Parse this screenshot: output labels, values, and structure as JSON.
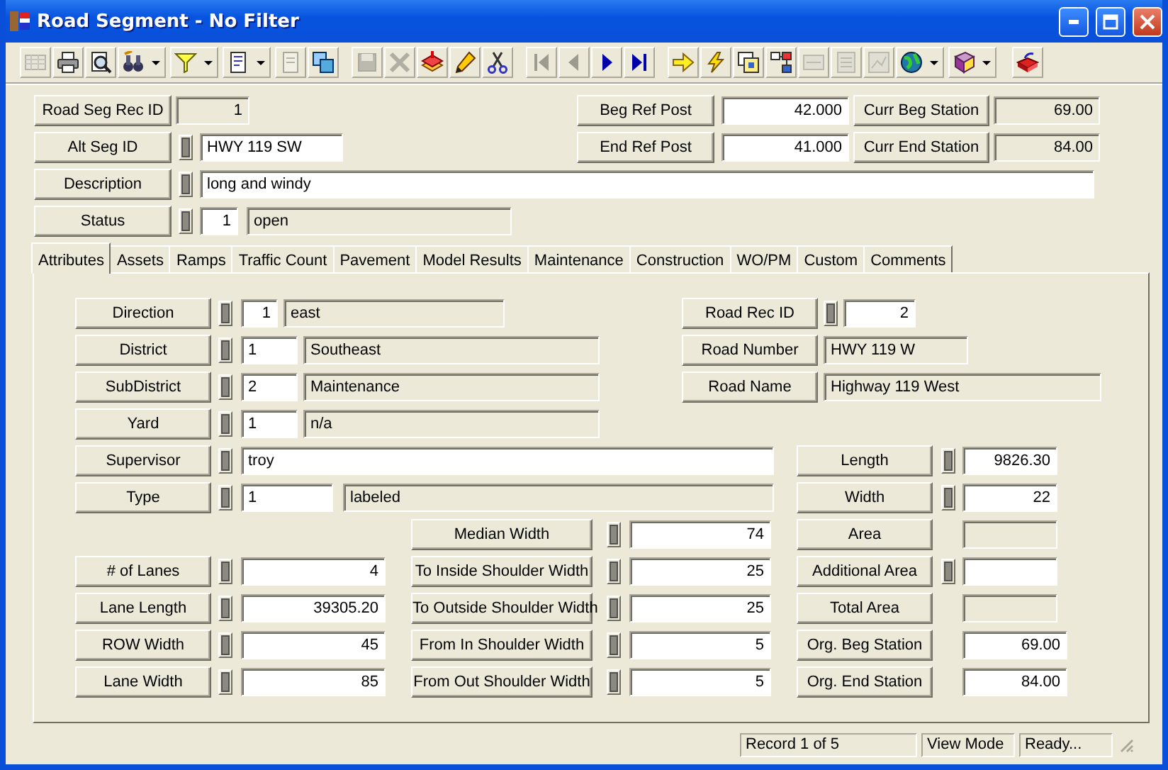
{
  "window": {
    "title": "Road Segment - No Filter"
  },
  "toolbar": {
    "groups": [
      [
        {
          "disabled": true,
          "dropdown": false
        },
        {
          "disabled": false,
          "dropdown": false
        },
        {
          "disabled": false,
          "dropdown": false
        },
        {
          "disabled": false,
          "dropdown": true
        },
        {
          "disabled": false,
          "dropdown": true
        },
        {
          "disabled": false,
          "dropdown": true
        },
        {
          "disabled": true,
          "dropdown": false
        },
        {
          "disabled": false,
          "dropdown": false
        }
      ],
      [
        {
          "disabled": true,
          "dropdown": false
        },
        {
          "disabled": true,
          "dropdown": false
        },
        {
          "disabled": false,
          "dropdown": false
        },
        {
          "disabled": false,
          "dropdown": false
        },
        {
          "disabled": false,
          "dropdown": false
        }
      ],
      [
        {
          "disabled": true,
          "dropdown": false
        },
        {
          "disabled": true,
          "dropdown": false
        },
        {
          "disabled": false,
          "dropdown": false
        },
        {
          "disabled": false,
          "dropdown": false
        }
      ],
      [
        {
          "disabled": false,
          "dropdown": false
        },
        {
          "disabled": false,
          "dropdown": false
        },
        {
          "disabled": false,
          "dropdown": false
        },
        {
          "disabled": false,
          "dropdown": false
        },
        {
          "disabled": true,
          "dropdown": false
        },
        {
          "disabled": true,
          "dropdown": false
        },
        {
          "disabled": true,
          "dropdown": false
        },
        {
          "disabled": false,
          "dropdown": true
        },
        {
          "disabled": false,
          "dropdown": true
        }
      ],
      [
        {
          "disabled": false,
          "dropdown": false
        }
      ]
    ]
  },
  "header": {
    "rows": [
      [
        {
          "kind": "plain",
          "label": "Road Seg Rec ID",
          "value": "1",
          "readonly": true
        },
        {
          "kind": "plain",
          "label": "Beg Ref Post",
          "value": "42.000",
          "readonly": false
        },
        {
          "kind": "plain",
          "label": "Curr Beg Station",
          "value": "69.00",
          "readonly": true
        }
      ],
      [
        {
          "kind": "toggle",
          "label": "Alt Seg ID",
          "value": "HWY 119 SW",
          "readonly": false
        },
        {
          "kind": "plain",
          "label": "End Ref Post",
          "value": "41.000",
          "readonly": false
        },
        {
          "kind": "plain",
          "label": "Curr End Station",
          "value": "84.00",
          "readonly": true
        }
      ],
      [
        {
          "kind": "toggle",
          "label": "Description",
          "value": "long and windy",
          "readonly": false
        }
      ],
      [
        {
          "kind": "toggle",
          "label": "Status",
          "code": "1",
          "value": "open",
          "readonly": true
        }
      ]
    ]
  },
  "tabs": [
    {
      "label": "Attributes",
      "selected": true
    },
    {
      "label": "Assets",
      "selected": false
    },
    {
      "label": "Ramps",
      "selected": false
    },
    {
      "label": "Traffic Count",
      "selected": false
    },
    {
      "label": "Pavement",
      "selected": false
    },
    {
      "label": "Model Results",
      "selected": false
    },
    {
      "label": "Maintenance",
      "selected": false
    },
    {
      "label": "Construction",
      "selected": false
    },
    {
      "label": "WO/PM",
      "selected": false
    },
    {
      "label": "Custom",
      "selected": false
    },
    {
      "label": "Comments",
      "selected": false
    }
  ],
  "attributes": {
    "rows": [
      [
        {
          "kind": "toggle",
          "label": "Direction",
          "code": "1",
          "value": "east",
          "readonly": true
        },
        {
          "kind": "toggle",
          "label": "Road Rec ID",
          "value": "2",
          "readonly": false
        }
      ],
      [
        {
          "kind": "toggle",
          "label": "District",
          "code": "1",
          "value": "Southeast",
          "readonly": true
        },
        {
          "kind": "plain",
          "label": "Road Number",
          "value": "HWY 119 W",
          "readonly": true
        }
      ],
      [
        {
          "kind": "toggle",
          "label": "SubDistrict",
          "code": "2",
          "value": "Maintenance",
          "readonly": true
        },
        {
          "kind": "plain",
          "label": "Road Name",
          "value": "Highway 119 West",
          "readonly": true
        }
      ],
      [
        {
          "kind": "toggle",
          "label": "Yard",
          "code": "1",
          "value": "n/a",
          "readonly": true
        }
      ],
      [
        {
          "kind": "toggle",
          "label": "Supervisor",
          "value": "troy",
          "readonly": false
        },
        {
          "kind": "toggle",
          "label": "Length",
          "value": "9826.30",
          "readonly": false
        }
      ],
      [
        {
          "kind": "toggle",
          "label": "Type",
          "code": "1",
          "value": "labeled",
          "readonly": true
        },
        {
          "kind": "toggle",
          "label": "Width",
          "value": "22",
          "readonly": false
        }
      ],
      [
        {
          "kind": "toggle",
          "label": "Median Width",
          "value": "74",
          "readonly": false
        },
        {
          "kind": "plain",
          "label": "Area",
          "readonly": true
        }
      ],
      [
        {
          "kind": "toggle",
          "label": "# of Lanes",
          "value": "4",
          "readonly": false
        },
        {
          "kind": "toggle",
          "label": "To Inside Shoulder Width",
          "value": "25",
          "readonly": false
        },
        {
          "kind": "toggle",
          "label": "Additional Area",
          "readonly": false
        }
      ],
      [
        {
          "kind": "toggle",
          "label": "Lane Length",
          "value": "39305.20",
          "readonly": false
        },
        {
          "kind": "toggle",
          "label": "To Outside Shoulder Width",
          "value": "25",
          "readonly": false
        },
        {
          "kind": "plain",
          "label": "Total Area",
          "readonly": true
        }
      ],
      [
        {
          "kind": "toggle",
          "label": "ROW Width",
          "value": "45",
          "readonly": false
        },
        {
          "kind": "toggle",
          "label": "From In Shoulder Width",
          "value": "5",
          "readonly": false
        },
        {
          "kind": "plain",
          "label": "Org. Beg Station",
          "value": "69.00",
          "readonly": false
        }
      ],
      [
        {
          "kind": "toggle",
          "label": "Lane Width",
          "value": "85",
          "readonly": false
        },
        {
          "kind": "toggle",
          "label": "From Out Shoulder Width",
          "value": "5",
          "readonly": false
        },
        {
          "kind": "plain",
          "label": "Org. End Station",
          "value": "84.00",
          "readonly": false
        }
      ]
    ]
  },
  "status_bar": [
    "Record 1 of 5",
    "View Mode",
    "Ready..."
  ]
}
